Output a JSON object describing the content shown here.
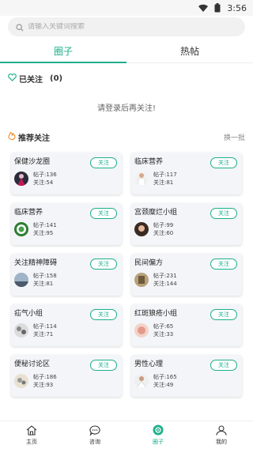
{
  "status": {
    "time": "3:56"
  },
  "search": {
    "placeholder": "请输入关键词搜索"
  },
  "tabs": [
    {
      "label": "圈子",
      "active": true
    },
    {
      "label": "热帖",
      "active": false
    }
  ],
  "followed": {
    "label": "已关注",
    "count": "(0)",
    "empty_tip": "请登录后再关注!"
  },
  "recommend": {
    "title": "推荐关注",
    "refresh_label": "换一批"
  },
  "cards": [
    {
      "name": "保健沙龙圈",
      "posts": "帖子:136",
      "follows": "关注:54",
      "button": "关注"
    },
    {
      "name": "临床营养",
      "posts": "帖子:117",
      "follows": "关注:81",
      "button": "关注"
    },
    {
      "name": "临床营养",
      "posts": "帖子:141",
      "follows": "关注:95",
      "button": "关注"
    },
    {
      "name": "宫颈糜烂小组",
      "posts": "帖子:99",
      "follows": "关注:60",
      "button": "关注"
    },
    {
      "name": "关注精神障碍",
      "posts": "帖子:158",
      "follows": "关注:81",
      "button": "关注"
    },
    {
      "name": "民间偏方",
      "posts": "帖子:231",
      "follows": "关注:144",
      "button": "关注"
    },
    {
      "name": "疝气小组",
      "posts": "帖子:114",
      "follows": "关注:71",
      "button": "关注"
    },
    {
      "name": "红斑狼疮小组",
      "posts": "帖子:65",
      "follows": "关注:33",
      "button": "关注"
    },
    {
      "name": "便秘讨论区",
      "posts": "帖子:186",
      "follows": "关注:93",
      "button": "关注"
    },
    {
      "name": "男性心理",
      "posts": "帖子:165",
      "follows": "关注:49",
      "button": "关注"
    }
  ],
  "bottom_nav": [
    {
      "label": "主页",
      "icon": "home-icon"
    },
    {
      "label": "咨询",
      "icon": "chat-icon"
    },
    {
      "label": "圈子",
      "icon": "circle-icon",
      "active": true
    },
    {
      "label": "我的",
      "icon": "user-icon"
    }
  ],
  "colors": {
    "accent": "#1fae8d",
    "card_bg": "#f3f5f8"
  }
}
